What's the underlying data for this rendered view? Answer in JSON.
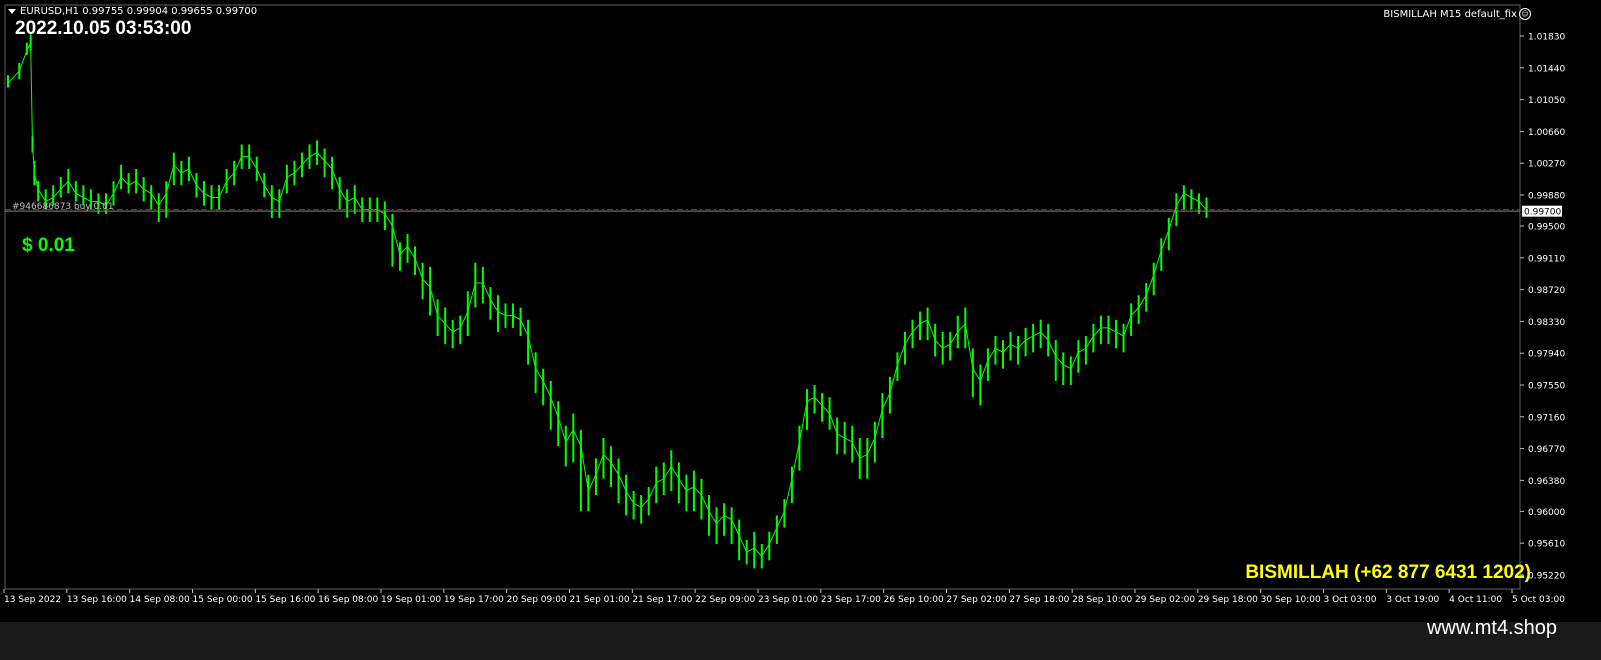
{
  "header": {
    "symbol_line": "EURUSD,H1  0.99755 0.99904 0.99655 0.99700",
    "ea_name": "BISMILLAH M15 default_fix"
  },
  "overlay": {
    "clock": "2022.10.05 03:53:00",
    "profit": "$ 0.01",
    "order_label": "#946686873 buy 0.01",
    "brand": "BISMILLAH (+62 877 6431 1202)"
  },
  "footer": {
    "site": "www.mt4.shop"
  },
  "colors": {
    "background": "#000000",
    "candles": "#00ff00",
    "order_line": "#ff0000",
    "text": "#ffffff",
    "brand": "#ffff00"
  },
  "chart_data": {
    "type": "line",
    "symbol": "EURUSD",
    "timeframe": "H1",
    "ohlc_last": {
      "open": 0.99755,
      "high": 0.99904,
      "low": 0.99655,
      "close": 0.997
    },
    "current_price": 0.997,
    "current_price_label": "0.99700",
    "ylim": [
      0.9522,
      1.0215
    ],
    "y_ticks": [
      1.0183,
      1.0144,
      1.0105,
      1.0066,
      1.0027,
      0.9988,
      0.995,
      0.9911,
      0.9872,
      0.9833,
      0.9794,
      0.9755,
      0.9716,
      0.9677,
      0.9638,
      0.96,
      0.9561,
      0.9522
    ],
    "y_tick_labels": [
      "1.01830",
      "1.01440",
      "1.01050",
      "1.00660",
      "1.00270",
      "0.99880",
      "0.99500",
      "0.99110",
      "0.98720",
      "0.98330",
      "0.97940",
      "0.97550",
      "0.97160",
      "0.96770",
      "0.96380",
      "0.96000",
      "0.95610",
      "0.95220"
    ],
    "x_tick_labels": [
      "13 Sep 2022",
      "13 Sep 16:00",
      "14 Sep 08:00",
      "15 Sep 00:00",
      "15 Sep 16:00",
      "16 Sep 08:00",
      "19 Sep 01:00",
      "19 Sep 17:00",
      "20 Sep 09:00",
      "21 Sep 01:00",
      "21 Sep 17:00",
      "22 Sep 09:00",
      "23 Sep 01:00",
      "23 Sep 17:00",
      "26 Sep 10:00",
      "27 Sep 02:00",
      "27 Sep 18:00",
      "28 Sep 10:00",
      "29 Sep 02:00",
      "29 Sep 18:00",
      "30 Sep 10:00",
      "3 Oct 03:00",
      "3 Oct 19:00",
      "4 Oct 11:00",
      "5 Oct 03:00"
    ],
    "series": [
      {
        "x": [
          0,
          3,
          5,
          6,
          6.5,
          7,
          8,
          10,
          12,
          14,
          16,
          18,
          20,
          22,
          24,
          26,
          28,
          30,
          32,
          34,
          36,
          38,
          40,
          42,
          44,
          46,
          48,
          50,
          52,
          54,
          56,
          58,
          60,
          62,
          64,
          66,
          68,
          70,
          72,
          74,
          76,
          78,
          80,
          82,
          84,
          86,
          88,
          90,
          92,
          94,
          96,
          98,
          100,
          102,
          104,
          106,
          108,
          110,
          112,
          114,
          116,
          118,
          120,
          122,
          124,
          126,
          128,
          130,
          132,
          134,
          136,
          138,
          140,
          142,
          144,
          146,
          148,
          150,
          152,
          154,
          156,
          158,
          160,
          162,
          164,
          166,
          168,
          170,
          172,
          174,
          176,
          178,
          180,
          182,
          184,
          186,
          188,
          190,
          192,
          194,
          196,
          198,
          200,
          202,
          204,
          206,
          208,
          210,
          212,
          214,
          216,
          218,
          220,
          222,
          224,
          226,
          228,
          230,
          232,
          234,
          236,
          238,
          240,
          242,
          244,
          246,
          248,
          250,
          252,
          254,
          256,
          258,
          260,
          262,
          264,
          266,
          268,
          270,
          272,
          274,
          276,
          278,
          280,
          282,
          284,
          286,
          288,
          290,
          292,
          294,
          296,
          298,
          300,
          302,
          304,
          306,
          308,
          310,
          312,
          314,
          316,
          318,
          320,
          322,
          324,
          326,
          328,
          330,
          332,
          334,
          336,
          338,
          340,
          342,
          344,
          346,
          348,
          350,
          352,
          354,
          356,
          358,
          360,
          362,
          364,
          366,
          368,
          370,
          372,
          374,
          376,
          378,
          380,
          382,
          384,
          386,
          388,
          390,
          392,
          394,
          396,
          398
        ],
        "close": [
          1.0125,
          1.014,
          1.0165,
          1.0175,
          1.005,
          1.0015,
          0.9995,
          0.998,
          0.9985,
          0.9995,
          1.0005,
          0.999,
          0.9985,
          0.998,
          0.998,
          0.9975,
          0.999,
          1.001,
          1.0,
          1.0005,
          0.9995,
          0.999,
          0.9975,
          0.999,
          1.0025,
          1.0015,
          1.002,
          1.0,
          0.999,
          0.9985,
          0.9985,
          1.0005,
          1.0015,
          1.0035,
          1.0035,
          1.002,
          1.0,
          0.9985,
          0.998,
          1.001,
          1.0015,
          1.0025,
          1.0035,
          1.004,
          1.003,
          1.002,
          0.9995,
          0.998,
          0.9985,
          0.997,
          0.997,
          0.997,
          0.9965,
          0.995,
          0.9915,
          0.9925,
          0.991,
          0.9885,
          0.9875,
          0.984,
          0.983,
          0.982,
          0.9825,
          0.9845,
          0.988,
          0.988,
          0.986,
          0.9845,
          0.984,
          0.984,
          0.9835,
          0.9815,
          0.9775,
          0.976,
          0.974,
          0.9715,
          0.9685,
          0.97,
          0.968,
          0.9625,
          0.9645,
          0.967,
          0.966,
          0.9645,
          0.9625,
          0.961,
          0.9605,
          0.9615,
          0.9635,
          0.964,
          0.9655,
          0.964,
          0.9625,
          0.963,
          0.962,
          0.96,
          0.9585,
          0.9595,
          0.959,
          0.957,
          0.955,
          0.9555,
          0.9545,
          0.956,
          0.958,
          0.96,
          0.964,
          0.9685,
          0.9735,
          0.974,
          0.973,
          0.972,
          0.9695,
          0.969,
          0.9685,
          0.9665,
          0.967,
          0.969,
          0.9725,
          0.9745,
          0.978,
          0.9805,
          0.982,
          0.983,
          0.9835,
          0.981,
          0.98,
          0.9805,
          0.982,
          0.983,
          0.9775,
          0.976,
          0.9785,
          0.98,
          0.9795,
          0.9805,
          0.98,
          0.981,
          0.9815,
          0.982,
          0.981,
          0.979,
          0.978,
          0.9775,
          0.9795,
          0.98,
          0.9815,
          0.9825,
          0.9825,
          0.982,
          0.9815,
          0.984,
          0.985,
          0.9865,
          0.989,
          0.992,
          0.9945,
          0.9975,
          0.999,
          0.9985,
          0.998,
          0.997
        ],
        "low": [
          1.012,
          1.013,
          1.016,
          1.0165,
          1.004,
          1.0,
          0.998,
          0.997,
          0.9975,
          0.9985,
          0.999,
          0.998,
          0.9975,
          0.997,
          0.9965,
          0.9965,
          0.9975,
          0.9995,
          0.999,
          0.999,
          0.998,
          0.997,
          0.9955,
          0.996,
          1.0,
          1.0,
          1.0005,
          0.9985,
          0.9975,
          0.997,
          0.997,
          0.999,
          1.0,
          1.002,
          1.002,
          1.0005,
          0.9985,
          0.996,
          0.996,
          0.999,
          1.0,
          1.001,
          1.002,
          1.0025,
          1.001,
          0.9995,
          0.997,
          0.996,
          0.9965,
          0.9955,
          0.9955,
          0.9955,
          0.9945,
          0.99,
          0.9895,
          0.9905,
          0.989,
          0.986,
          0.984,
          0.9815,
          0.9805,
          0.98,
          0.9805,
          0.9815,
          0.985,
          0.9855,
          0.9835,
          0.982,
          0.9825,
          0.9825,
          0.9815,
          0.978,
          0.9745,
          0.973,
          0.97,
          0.968,
          0.9655,
          0.966,
          0.96,
          0.96,
          0.962,
          0.964,
          0.963,
          0.961,
          0.9595,
          0.959,
          0.9585,
          0.9595,
          0.961,
          0.962,
          0.9625,
          0.961,
          0.96,
          0.96,
          0.959,
          0.957,
          0.956,
          0.957,
          0.956,
          0.954,
          0.9535,
          0.953,
          0.953,
          0.954,
          0.956,
          0.958,
          0.961,
          0.965,
          0.97,
          0.972,
          0.971,
          0.97,
          0.967,
          0.967,
          0.966,
          0.964,
          0.964,
          0.966,
          0.969,
          0.972,
          0.976,
          0.978,
          0.98,
          0.981,
          0.981,
          0.979,
          0.978,
          0.9785,
          0.98,
          0.98,
          0.974,
          0.973,
          0.976,
          0.978,
          0.9775,
          0.9785,
          0.978,
          0.979,
          0.9795,
          0.98,
          0.979,
          0.976,
          0.9755,
          0.9755,
          0.977,
          0.978,
          0.9795,
          0.9805,
          0.9805,
          0.98,
          0.9795,
          0.9815,
          0.983,
          0.9845,
          0.9865,
          0.9895,
          0.992,
          0.995,
          0.997,
          0.997,
          0.9965,
          0.996
        ],
        "high": [
          1.0135,
          1.015,
          1.0175,
          1.0185,
          1.006,
          1.003,
          1.0005,
          0.9995,
          1.0,
          1.001,
          1.002,
          1.0005,
          1.0,
          0.9995,
          0.999,
          0.999,
          1.0005,
          1.0025,
          1.0015,
          1.002,
          1.001,
          1.0,
          0.999,
          1.0005,
          1.004,
          1.003,
          1.0035,
          1.0015,
          1.0005,
          1.0,
          1.0,
          1.002,
          1.003,
          1.005,
          1.005,
          1.0035,
          1.0015,
          1.0,
          0.9995,
          1.0025,
          1.003,
          1.004,
          1.005,
          1.0055,
          1.0045,
          1.0035,
          1.001,
          0.9995,
          1.0,
          0.9985,
          0.9985,
          0.9985,
          0.998,
          0.9965,
          0.993,
          0.994,
          0.9925,
          0.9905,
          0.99,
          0.986,
          0.985,
          0.9835,
          0.984,
          0.987,
          0.9905,
          0.99,
          0.9875,
          0.9865,
          0.9855,
          0.9855,
          0.985,
          0.9835,
          0.9795,
          0.9775,
          0.976,
          0.9735,
          0.9705,
          0.972,
          0.97,
          0.9645,
          0.9665,
          0.969,
          0.968,
          0.9665,
          0.9645,
          0.9625,
          0.962,
          0.963,
          0.9655,
          0.966,
          0.9675,
          0.966,
          0.9645,
          0.965,
          0.964,
          0.962,
          0.9605,
          0.961,
          0.9605,
          0.959,
          0.9565,
          0.9575,
          0.956,
          0.9575,
          0.9595,
          0.9615,
          0.9655,
          0.9705,
          0.975,
          0.9755,
          0.9745,
          0.974,
          0.9715,
          0.971,
          0.9705,
          0.969,
          0.969,
          0.971,
          0.9745,
          0.9765,
          0.9795,
          0.982,
          0.9835,
          0.9845,
          0.985,
          0.983,
          0.982,
          0.982,
          0.984,
          0.985,
          0.98,
          0.978,
          0.98,
          0.9815,
          0.981,
          0.982,
          0.9815,
          0.9825,
          0.983,
          0.9835,
          0.983,
          0.981,
          0.9795,
          0.979,
          0.981,
          0.9815,
          0.983,
          0.984,
          0.984,
          0.9835,
          0.983,
          0.9855,
          0.9865,
          0.988,
          0.9905,
          0.9935,
          0.996,
          0.999,
          1.0,
          0.9995,
          0.999,
          0.9985
        ]
      }
    ],
    "order_line_price": 0.997,
    "grid": false,
    "legend": "none"
  }
}
